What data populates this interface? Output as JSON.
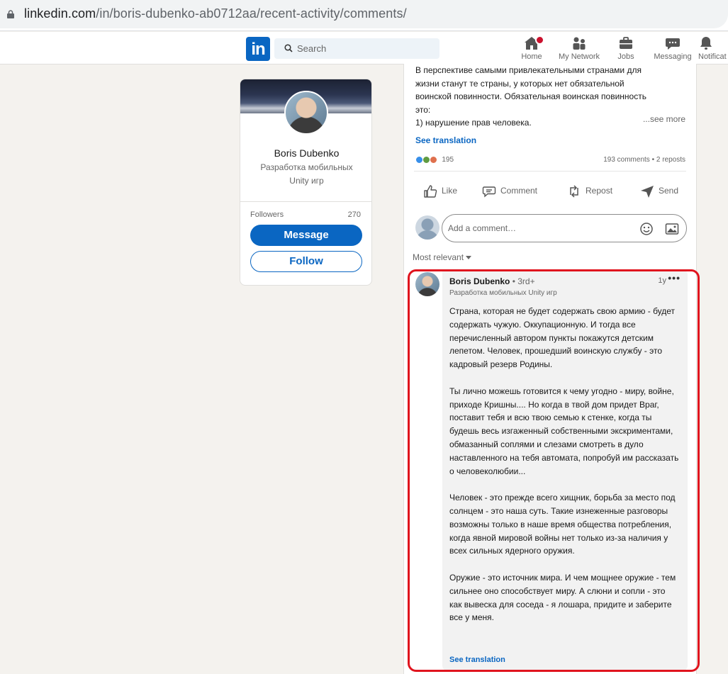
{
  "browser": {
    "url_host": "linkedin.com",
    "url_path": "/in/boris-dubenko-ab0712aa/recent-activity/comments/"
  },
  "nav": {
    "logo": "in",
    "search_placeholder": "Search",
    "items": [
      {
        "label": "Home",
        "icon": "home-icon",
        "badge": true
      },
      {
        "label": "My Network",
        "icon": "network-icon"
      },
      {
        "label": "Jobs",
        "icon": "briefcase-icon"
      },
      {
        "label": "Messaging",
        "icon": "messaging-icon"
      },
      {
        "label": "Notificat",
        "icon": "bell-icon"
      }
    ]
  },
  "profile": {
    "name": "Boris Dubenko",
    "headline": "Разработка мобильных Unity игр",
    "followers_label": "Followers",
    "followers_count": "270",
    "message_label": "Message",
    "follow_label": "Follow"
  },
  "post": {
    "text_lines": [
      "В перспективе самыми привлекательными странами для",
      "жизни станут те страны, у которых нет обязательной",
      "воинской повинности. Обязательная воинская повинность",
      "это:",
      "1) нарушение прав человека."
    ],
    "see_more": "...see more",
    "see_translation": "See translation",
    "reaction_count": "195",
    "comments_count": "193 comments",
    "separator": " • ",
    "reposts_count": "2 reposts",
    "actions": {
      "like": "Like",
      "comment": "Comment",
      "repost": "Repost",
      "send": "Send"
    },
    "comment_placeholder": "Add a comment…",
    "sort_label": "Most relevant"
  },
  "comment": {
    "author": "Boris Dubenko",
    "degree": "• 3rd+",
    "headline": "Разработка мобильных Unity игр",
    "time": "1y",
    "more": "•••",
    "paragraphs": [
      "Страна, которая не будет содержать свою армию - будет содержать чужую. Оккупационную. И тогда все перечисленный автором пункты покажутся детским лепетом. Человек, прошедший воинскую службу - это кадровый резерв Родины.",
      "Ты лично можешь готовится к чему угодно - миру, войне, приходе Кришны.... Но когда в твой дом придет Враг, поставит тебя и всю твою семью к стенке, когда ты будешь весь изгаженный собственными экскриментами, обмазанный соплями и слезами смотреть в дуло наставленного на тебя автомата, попробуй им рассказать о человеколюбии...",
      "Человек - это прежде всего хищник, борьба за место под солнцем - это наша суть. Такие изнеженные разговоры возможны только в наше время общества потребления, когда явной мировой войны нет только из-за наличия у всех сильных ядерного оружия.",
      "Оружие - это источник мира. И чем мощнее оружие - тем сильнее оно способствует миру. А слюни и сопли - это как вывеска для соседа - я лошара, придите и заберите все у меня."
    ],
    "see_translation": "See translation"
  },
  "colors": {
    "brand": "#0a66c2",
    "highlight": "#e0141e",
    "page_bg": "#f4f2ee"
  }
}
